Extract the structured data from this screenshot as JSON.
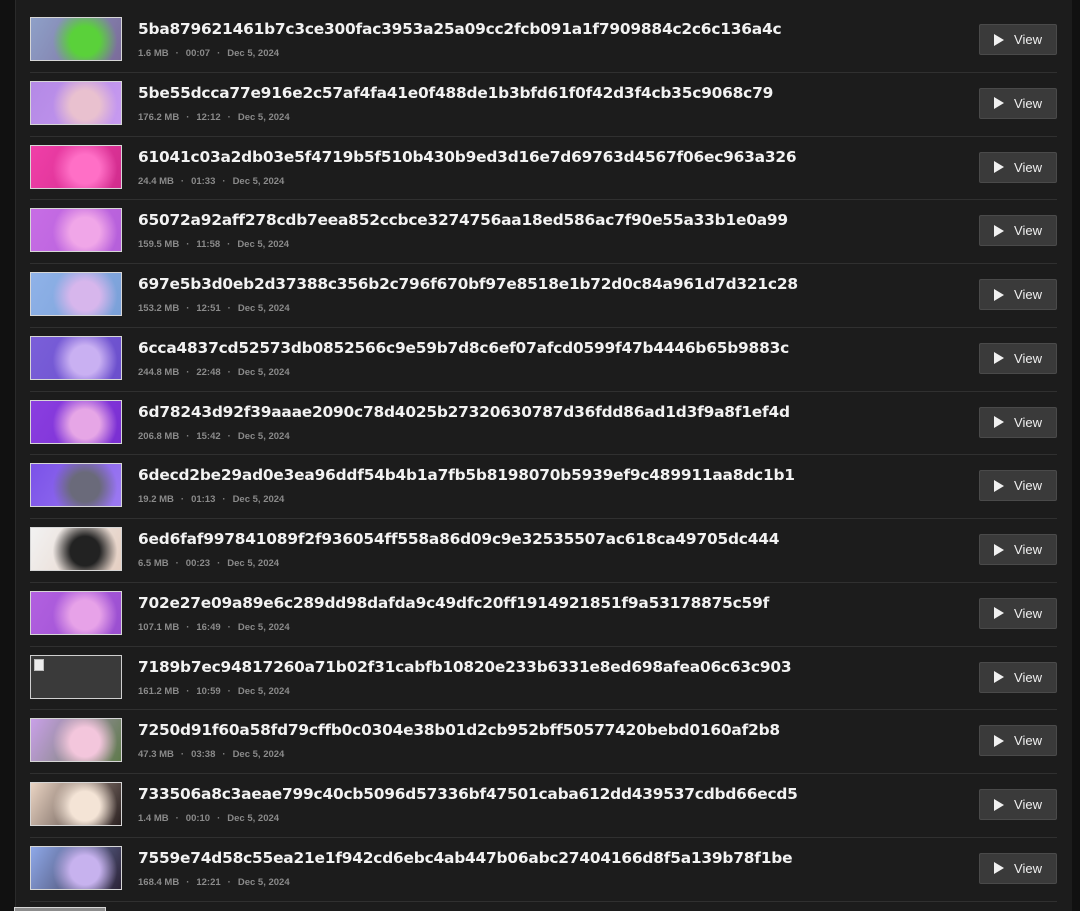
{
  "buttons": {
    "view_label": "View"
  },
  "videos": [
    {
      "id": "5ba879621461b7c3ce300fac3953a25a09cc2fcb091a1f7909884c2c6c136a4c",
      "size": "1.6 MB",
      "duration": "00:07",
      "date": "Dec 5, 2024",
      "thumb_colors": [
        "#8ea0c8",
        "#5ad13a",
        "#7b6b9a"
      ],
      "thumb_broken": false
    },
    {
      "id": "5be55dcca77e916e2c57af4fa41e0f488de1b3bfd61f0f42d3f4cb35c9068c79",
      "size": "176.2 MB",
      "duration": "12:12",
      "date": "Dec 5, 2024",
      "thumb_colors": [
        "#b489e6",
        "#e9c1cf",
        "#c79af0"
      ],
      "thumb_broken": false
    },
    {
      "id": "61041c03a2db03e5f4719b5f510b430b9ed3d16e7d69763d4567f06ec963a326",
      "size": "24.4 MB",
      "duration": "01:33",
      "date": "Dec 5, 2024",
      "thumb_colors": [
        "#f03fa8",
        "#ff6fc6",
        "#d12c8d"
      ],
      "thumb_broken": false
    },
    {
      "id": "65072a92aff278cdb7eea852ccbce3274756aa18ed586ac7f90e55a33b1e0a99",
      "size": "159.5 MB",
      "duration": "11:58",
      "date": "Dec 5, 2024",
      "thumb_colors": [
        "#c76de5",
        "#f0a6e8",
        "#b55fda"
      ],
      "thumb_broken": false
    },
    {
      "id": "697e5b3d0eb2d37388c356b2c796f670bf97e8518e1b72d0c84a961d7d321c28",
      "size": "153.2 MB",
      "duration": "12:51",
      "date": "Dec 5, 2024",
      "thumb_colors": [
        "#8fb2e8",
        "#d7b6ec",
        "#7aa0d8"
      ],
      "thumb_broken": false
    },
    {
      "id": "6cca4837cd52573db0852566c9e59b7d8c6ef07afcd0599f47b4446b65b9883c",
      "size": "244.8 MB",
      "duration": "22:48",
      "date": "Dec 5, 2024",
      "thumb_colors": [
        "#7a5fd9",
        "#c9b0f2",
        "#6b4fcc"
      ],
      "thumb_broken": false
    },
    {
      "id": "6d78243d92f39aaae2090c78d4025b27320630787d36fdd86ad1d3f9a8f1ef4d",
      "size": "206.8 MB",
      "duration": "15:42",
      "date": "Dec 5, 2024",
      "thumb_colors": [
        "#8a3ee0",
        "#e6a6e6",
        "#7a2fd2"
      ],
      "thumb_broken": false
    },
    {
      "id": "6decd2be29ad0e3ea96ddf54b4b1a7fb5b8198070b5939ef9c489911aa8dc1b1",
      "size": "19.2 MB",
      "duration": "01:13",
      "date": "Dec 5, 2024",
      "thumb_colors": [
        "#7b52e8",
        "#6a6a7a",
        "#9c7af2"
      ],
      "thumb_broken": false
    },
    {
      "id": "6ed6faf997841089f2f936054ff558a86d09c9e32535507ac618ca49705dc444",
      "size": "6.5 MB",
      "duration": "00:23",
      "date": "Dec 5, 2024",
      "thumb_colors": [
        "#f2f2f2",
        "#222222",
        "#e5cfc2"
      ],
      "thumb_broken": false
    },
    {
      "id": "702e27e09a89e6c289dd98dafda9c49dfc20ff1914921851f9a53178875c59f",
      "size": "107.1 MB",
      "duration": "16:49",
      "date": "Dec 5, 2024",
      "thumb_colors": [
        "#b260e0",
        "#e7a2e8",
        "#9a4fd0"
      ],
      "thumb_broken": false
    },
    {
      "id": "7189b7ec94817260a71b02f31cabfb10820e233b6331e8ed698afea06c63c903",
      "size": "161.2 MB",
      "duration": "10:59",
      "date": "Dec 5, 2024",
      "thumb_colors": [
        "#3a3a3a",
        "#3a3a3a",
        "#3a3a3a"
      ],
      "thumb_broken": true
    },
    {
      "id": "7250d91f60a58fd79cffb0c0304e38b01d2cb952bff50577420bebd0160af2b8",
      "size": "47.3 MB",
      "duration": "03:38",
      "date": "Dec 5, 2024",
      "thumb_colors": [
        "#c9a0e8",
        "#f3c6dc",
        "#5e7a4a"
      ],
      "thumb_broken": false
    },
    {
      "id": "733506a8c3aeae799c40cb5096d57336bf47501caba612dd439537cdbd66ecd5",
      "size": "1.4 MB",
      "duration": "00:10",
      "date": "Dec 5, 2024",
      "thumb_colors": [
        "#e9d3c2",
        "#f4e4d6",
        "#2a2020"
      ],
      "thumb_broken": false
    },
    {
      "id": "7559e74d58c55ea21e1f942cd6ebc4ab447b06abc27404166d8f5a139b78f1be",
      "size": "168.4 MB",
      "duration": "12:21",
      "date": "Dec 5, 2024",
      "thumb_colors": [
        "#8ea8e8",
        "#c7b2ee",
        "#2b2236"
      ],
      "thumb_broken": false
    }
  ]
}
